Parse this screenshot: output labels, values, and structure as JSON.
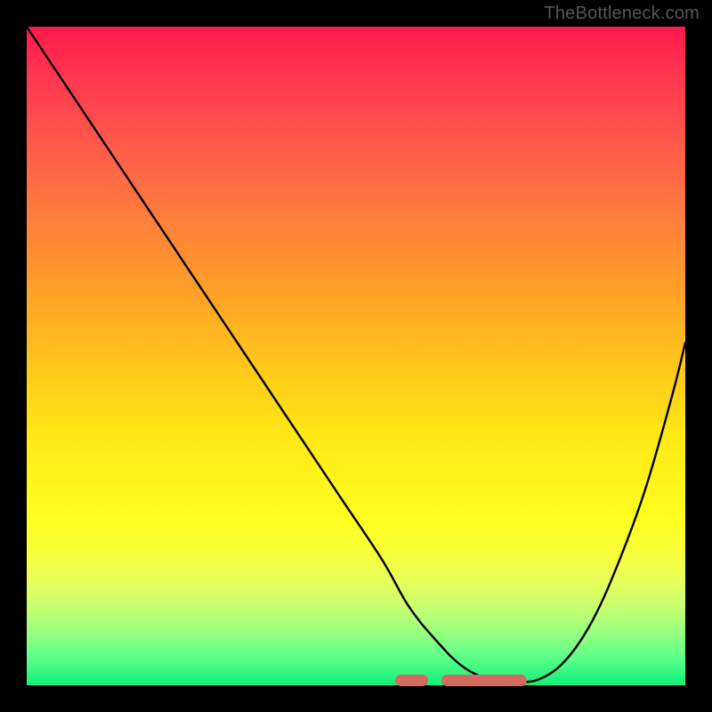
{
  "watermark": "TheBottleneck.com",
  "chart_data": {
    "type": "line",
    "title": "",
    "xlabel": "",
    "ylabel": "",
    "xlim": [
      0,
      100
    ],
    "ylim": [
      0,
      100
    ],
    "grid": false,
    "legend": false,
    "series": [
      {
        "name": "curve",
        "x": [
          0,
          6,
          12,
          18,
          24,
          30,
          36,
          42,
          48,
          54,
          58,
          62,
          66,
          70,
          74,
          78,
          82,
          86,
          90,
          94,
          98,
          100
        ],
        "y": [
          100,
          91,
          82,
          73,
          64,
          55,
          46,
          37,
          28,
          19,
          12,
          7,
          3,
          1,
          0.5,
          1,
          4,
          10,
          19,
          30,
          44,
          52
        ]
      }
    ],
    "highlight_segments": [
      {
        "x_start": 56,
        "x_end": 61
      },
      {
        "x_start": 63,
        "x_end": 76
      }
    ],
    "background_gradient": {
      "top": "#ff1a4d",
      "bottom": "#10f078"
    },
    "outer_background": "#000000"
  }
}
